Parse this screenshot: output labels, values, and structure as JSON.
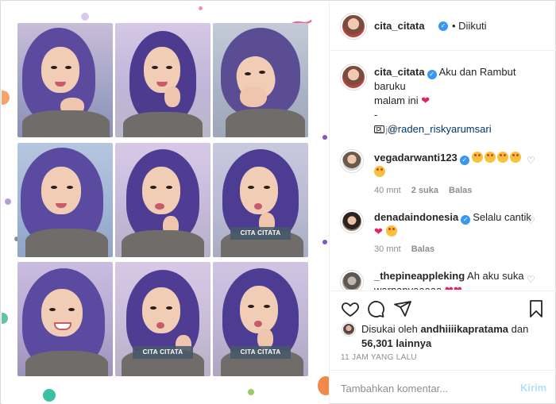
{
  "post": {
    "author": "cita_citata",
    "follow_status": "• Diikuti",
    "photo_caption_overlay": "CITA CITATA"
  },
  "caption": {
    "username": "cita_citata",
    "text_line1": "Aku dan Rambut baruku",
    "text_line2": "malam ini",
    "dash": "-",
    "camera_credit": "@raden_riskyarumsari",
    "age": "11 jam"
  },
  "comments": [
    {
      "username": "vegadarwanti123",
      "emoji_count": 5,
      "age": "40 mnt",
      "likes": "2 suka",
      "reply": "Balas"
    },
    {
      "username": "denadaindonesia",
      "text": "Selalu cantik",
      "age": "30 mnt",
      "reply": "Balas"
    },
    {
      "username": "_thepineappleking",
      "text": "Ah aku suka",
      "text_line2": "warnanyaaaaa"
    }
  ],
  "likes": {
    "prefix": "Disukai oleh",
    "user": "andhiiiikapratama",
    "joiner": "dan",
    "others": "56,301 lainnya"
  },
  "timestamp": "11 JAM YANG LALU",
  "comment_box": {
    "placeholder": "Tambahkan komentar...",
    "post_label": "Kirim"
  },
  "icons": {
    "like": "heart-outline-icon",
    "comment": "speech-bubble-icon",
    "share": "paper-plane-icon",
    "save": "bookmark-icon"
  },
  "colors": {
    "verified": "#3897f0",
    "link": "#00376b",
    "muted": "#8e8e8e",
    "post_disabled": "#b2dffc",
    "heart": "#e0245e"
  }
}
